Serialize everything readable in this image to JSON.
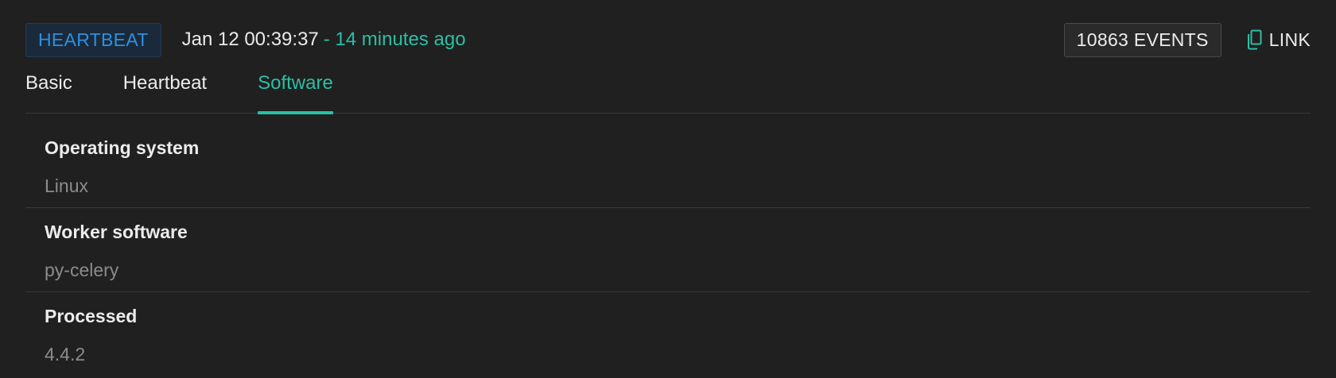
{
  "header": {
    "type_badge": "HEARTBEAT",
    "timestamp": "Jan 12 00:39:37",
    "relative_time": "- 14 minutes ago",
    "events_count": "10863 EVENTS",
    "link_label": "LINK",
    "link_icon": "copy-icon"
  },
  "tabs": [
    {
      "label": "Basic",
      "active": false
    },
    {
      "label": "Heartbeat",
      "active": false
    },
    {
      "label": "Software",
      "active": true
    }
  ],
  "fields": [
    {
      "label": "Operating system",
      "value": "Linux"
    },
    {
      "label": "Worker software",
      "value": "py-celery"
    },
    {
      "label": "Processed",
      "value": "4.4.2"
    }
  ],
  "colors": {
    "background": "#202020",
    "accent": "#2bbfa4",
    "badge_blue": "#2f8fe0",
    "muted_text": "#8c8c8c"
  }
}
